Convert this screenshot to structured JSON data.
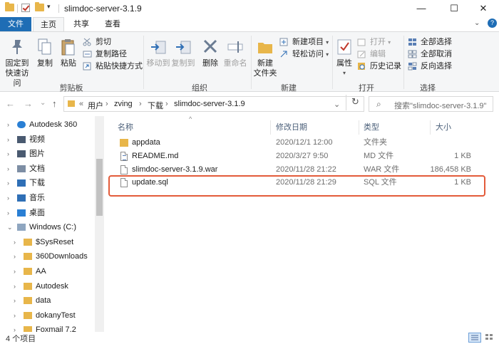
{
  "window": {
    "title": "slimdoc-server-3.1.9",
    "minimize_glyph": "—",
    "maximize_glyph": "☐",
    "close_glyph": "✕",
    "dropdown_glyph": "▾"
  },
  "tabs": {
    "file": "文件",
    "home": "主页",
    "share": "共享",
    "view": "查看",
    "help_glyph": "?"
  },
  "ribbon": {
    "clipboard": {
      "label": "剪贴板",
      "pin": "固定到\n快速访问",
      "copy": "复制",
      "paste": "粘贴",
      "cut": "剪切",
      "copy_path": "复制路径",
      "paste_shortcut": "粘贴快捷方式"
    },
    "organize": {
      "label": "组织",
      "move_to": "移动到",
      "copy_to": "复制到",
      "delete": "删除",
      "rename": "重命名"
    },
    "new": {
      "label": "新建",
      "new_folder": "新建\n文件夹",
      "new_item": "新建项目",
      "easy_access": "轻松访问"
    },
    "open": {
      "label": "打开",
      "properties": "属性",
      "open": "打开",
      "edit": "编辑",
      "history": "历史记录"
    },
    "select": {
      "label": "选择",
      "select_all": "全部选择",
      "select_none": "全部取消",
      "invert": "反向选择"
    }
  },
  "nav": {
    "back_glyph": "←",
    "forward_glyph": "→",
    "recent_glyph": "⌄",
    "up_glyph": "↑",
    "breadcrumb": [
      "«",
      "用户",
      "zving",
      "下载",
      "slimdoc-server-3.1.9"
    ],
    "address_dropdown": "⌄",
    "refresh_glyph": "↻",
    "search_placeholder": "搜索\"slimdoc-server-3.1.9\"",
    "search_glyph": "⌕"
  },
  "tree": [
    {
      "label": "Autodesk 360",
      "icon": "cloud-icon",
      "expander": "›",
      "level": 0
    },
    {
      "label": "视频",
      "icon": "video-folder-icon",
      "expander": "›",
      "level": 0
    },
    {
      "label": "图片",
      "icon": "pictures-folder-icon",
      "expander": "›",
      "level": 0
    },
    {
      "label": "文档",
      "icon": "documents-folder-icon",
      "expander": "›",
      "level": 0
    },
    {
      "label": "下载",
      "icon": "download-folder-icon",
      "expander": "›",
      "level": 0
    },
    {
      "label": "音乐",
      "icon": "music-folder-icon",
      "expander": "›",
      "level": 0
    },
    {
      "label": "桌面",
      "icon": "desktop-folder-icon",
      "expander": "›",
      "level": 0
    },
    {
      "label": "Windows (C:)",
      "icon": "drive-icon",
      "expander": "⌄",
      "level": 0
    },
    {
      "label": "$SysReset",
      "icon": "folder-icon",
      "expander": "›",
      "level": 1
    },
    {
      "label": "360Downloads",
      "icon": "folder-icon",
      "expander": "›",
      "level": 1
    },
    {
      "label": "AA",
      "icon": "folder-icon",
      "expander": "›",
      "level": 1
    },
    {
      "label": "Autodesk",
      "icon": "folder-icon",
      "expander": "›",
      "level": 1
    },
    {
      "label": "data",
      "icon": "folder-icon",
      "expander": "›",
      "level": 1
    },
    {
      "label": "dokanyTest",
      "icon": "folder-icon",
      "expander": "›",
      "level": 1
    },
    {
      "label": "Foxmail 7.2",
      "icon": "folder-icon",
      "expander": "›",
      "level": 1
    }
  ],
  "columns": {
    "name": "名称",
    "date": "修改日期",
    "type": "类型",
    "size": "大小",
    "sort_glyph": "^"
  },
  "files": [
    {
      "name": "appdata",
      "date": "2020/12/1 12:00",
      "type": "文件夹",
      "size": "",
      "icon": "folder-icon"
    },
    {
      "name": "README.md",
      "date": "2020/3/27 9:50",
      "type": "MD 文件",
      "size": "1 KB",
      "icon": "md-file-icon"
    },
    {
      "name": "slimdoc-server-3.1.9.war",
      "date": "2020/11/28 21:22",
      "type": "WAR 文件",
      "size": "186,458 KB",
      "icon": "war-file-icon"
    },
    {
      "name": "update.sql",
      "date": "2020/11/28 21:29",
      "type": "SQL 文件",
      "size": "1 KB",
      "icon": "sql-file-icon",
      "highlighted": true
    }
  ],
  "status": {
    "count": "4 个项目"
  },
  "colors": {
    "accent": "#1e6db5",
    "folder": "#e8b64a",
    "highlight": "#e35b3a"
  }
}
